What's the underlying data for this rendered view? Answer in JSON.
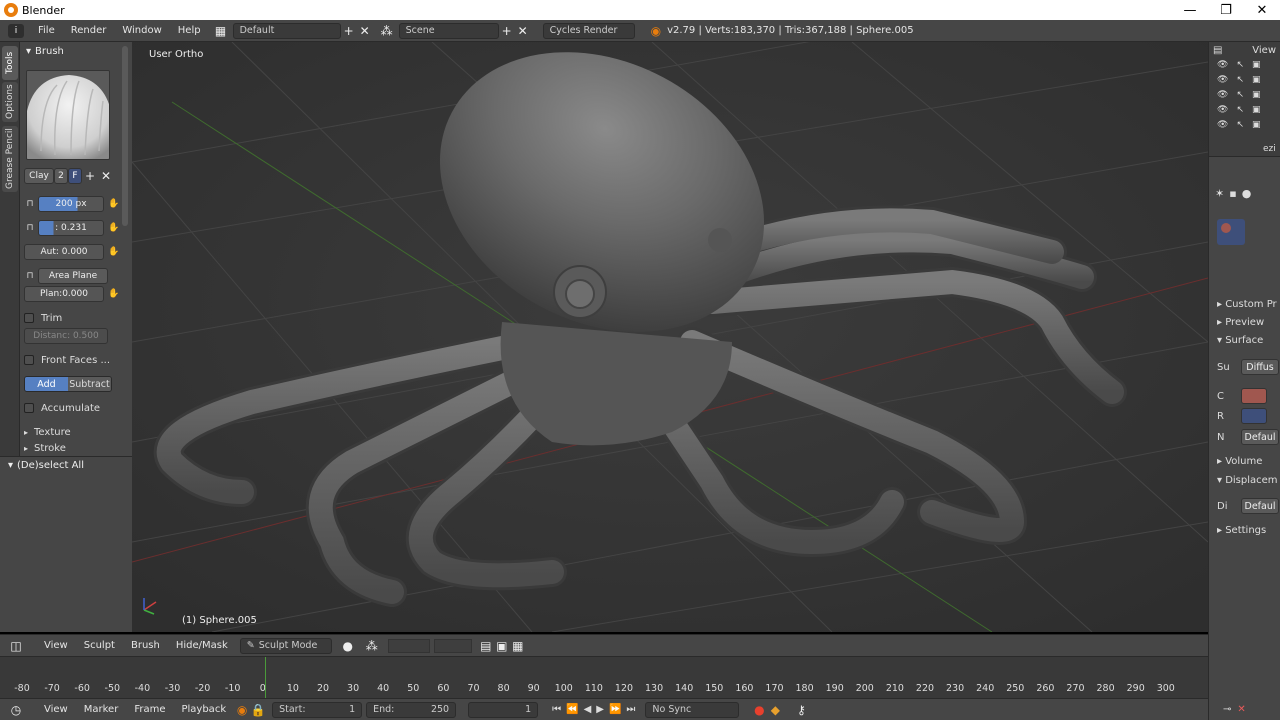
{
  "window": {
    "title": "Blender",
    "minimize": "—",
    "maximize": "❐",
    "close": "✕"
  },
  "info_header": {
    "menus": [
      "File",
      "Render",
      "Window",
      "Help"
    ],
    "layout": "Default",
    "scene": "Scene",
    "engine": "Cycles Render",
    "stats": "v2.79 | Verts:183,370 | Tris:367,188 | Sphere.005"
  },
  "toolshelf": {
    "tabs": [
      "Tools",
      "Options",
      "Grease Pencil"
    ],
    "brush_panel": "Brush",
    "brush_name": "Clay",
    "brush_users": "2",
    "fake_user": "F",
    "radius": "200 px",
    "strength": ": 0.231",
    "autosmooth": "Aut: 0.000",
    "sculpt_plane": "Area Plane",
    "plane_offset": "Plan:0.000",
    "trim_label": "Trim",
    "distance": "Distanc: 0.500",
    "front_faces": "Front Faces ...",
    "add": "Add",
    "subtract": "Subtract",
    "accumulate": "Accumulate",
    "texture_panel": "Texture",
    "stroke_panel": "Stroke",
    "operator_panel": "(De)select All"
  },
  "viewport": {
    "view_name": "User Ortho",
    "object_label": "(1) Sphere.005"
  },
  "outliner": {
    "view_menu": "View",
    "search_fragment": "ezi"
  },
  "properties": {
    "panels": [
      "Custom Pr",
      "Preview",
      "Surface",
      "Volume",
      "Displacem",
      "Settings"
    ],
    "surface_label": "Su",
    "surface_value": "Diffus",
    "color_label": "C",
    "roughness_label": "R",
    "normal_label": "N",
    "normal_value": "Defaul",
    "disp_label": "Di",
    "disp_value": "Defaul",
    "color": "#a0574f"
  },
  "viewport_header": {
    "menus": [
      "View",
      "Sculpt",
      "Brush",
      "Hide/Mask"
    ],
    "mode": "Sculpt Mode"
  },
  "timeline": {
    "ticks": [
      "-80",
      "-70",
      "-60",
      "-50",
      "-40",
      "-30",
      "-20",
      "-10",
      "0",
      "10",
      "20",
      "30",
      "40",
      "50",
      "60",
      "70",
      "80",
      "90",
      "100",
      "110",
      "120",
      "130",
      "140",
      "150",
      "160",
      "170",
      "180",
      "190",
      "200",
      "210",
      "220",
      "230",
      "240",
      "250",
      "260",
      "270",
      "280",
      "290",
      "300"
    ],
    "menus": [
      "View",
      "Marker",
      "Frame",
      "Playback"
    ],
    "start_label": "Start:",
    "start_value": "1",
    "end_label": "End:",
    "end_value": "250",
    "current_frame": "1",
    "sync": "No Sync"
  }
}
